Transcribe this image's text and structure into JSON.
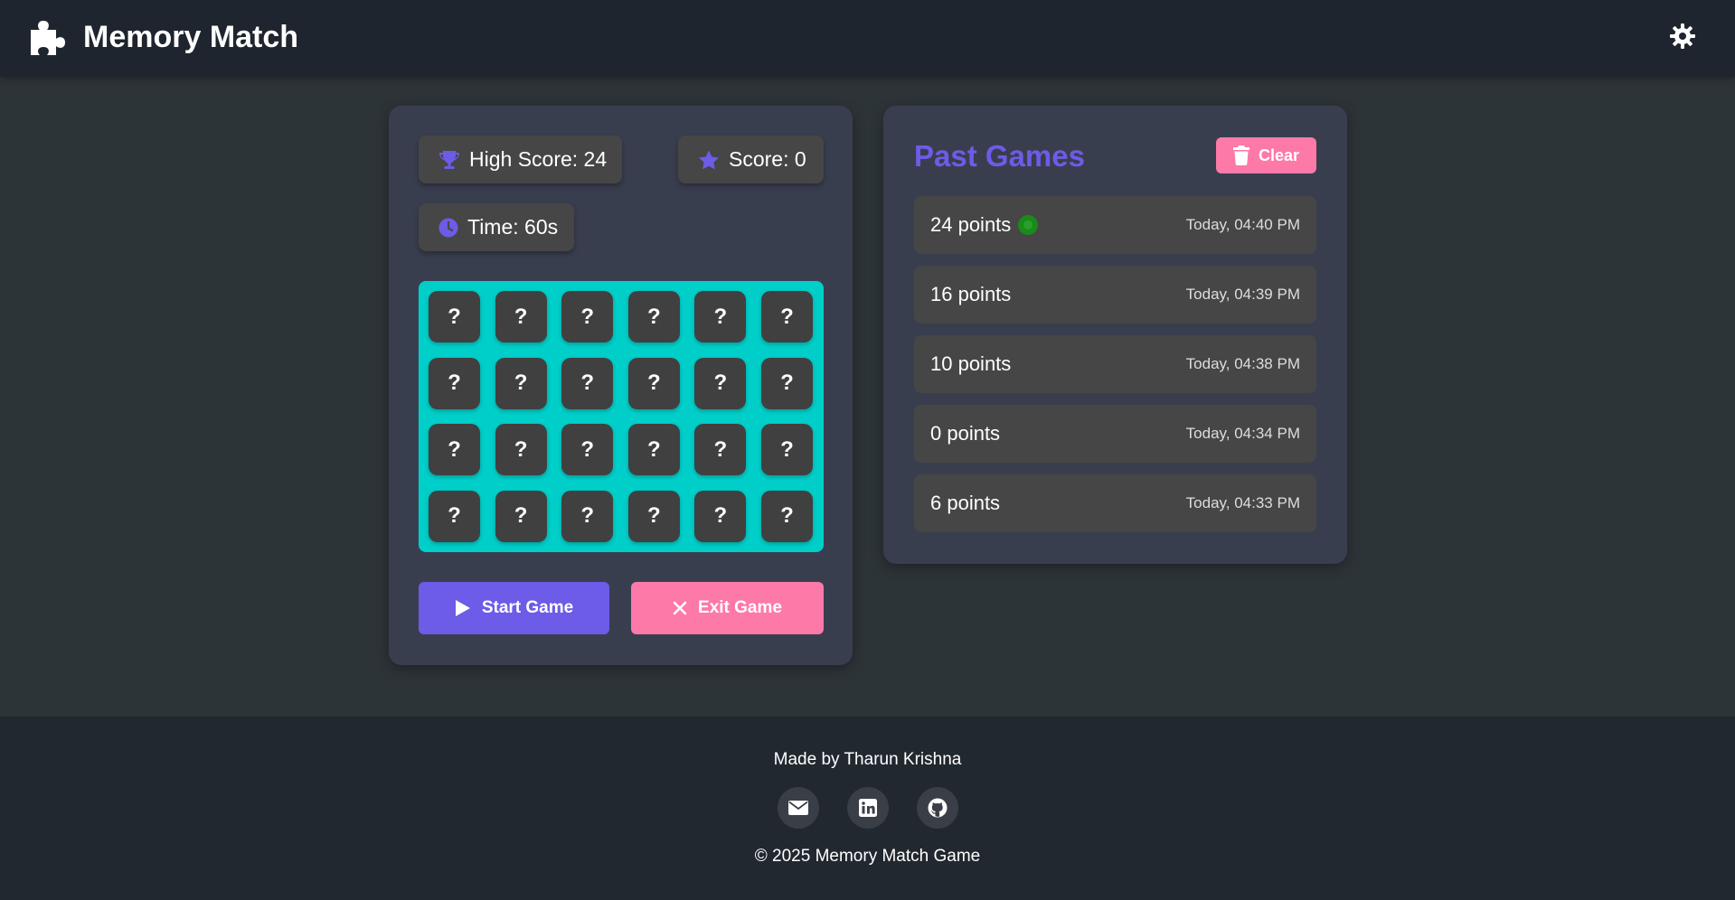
{
  "header": {
    "title": "Memory Match",
    "logo_icon": "puzzle-piece-icon",
    "settings_icon": "gear-icon"
  },
  "stats": {
    "high_score": "High Score: 24",
    "score": "Score: 0",
    "time": "Time: 60s",
    "icons": [
      "trophy-icon",
      "star-icon",
      "clock-icon"
    ]
  },
  "board": {
    "rows": 4,
    "cols": 6,
    "hidden_symbol": "?",
    "background": "#00cec9"
  },
  "controls": {
    "start_label": "Start Game",
    "exit_label": "Exit Game"
  },
  "history": {
    "title": "Past Games",
    "clear_label": "Clear",
    "items": [
      {
        "points": "24 points",
        "time": "Today, 04:40 PM",
        "best": true
      },
      {
        "points": "16 points",
        "time": "Today, 04:39 PM",
        "best": false
      },
      {
        "points": "10 points",
        "time": "Today, 04:38 PM",
        "best": false
      },
      {
        "points": "0 points",
        "time": "Today, 04:34 PM",
        "best": false
      },
      {
        "points": "6 points",
        "time": "Today, 04:33 PM",
        "best": false
      }
    ]
  },
  "footer": {
    "made_by": "Made by Tharun Krishna",
    "copyright": "© 2025 Memory Match Game",
    "social_icons": [
      "envelope-icon",
      "linkedin-icon",
      "github-icon"
    ]
  },
  "colors": {
    "accent": "#6c5ce7",
    "danger": "#fd79a8",
    "board": "#00cec9",
    "panel": "#393e4f",
    "background": "#2d3438"
  }
}
